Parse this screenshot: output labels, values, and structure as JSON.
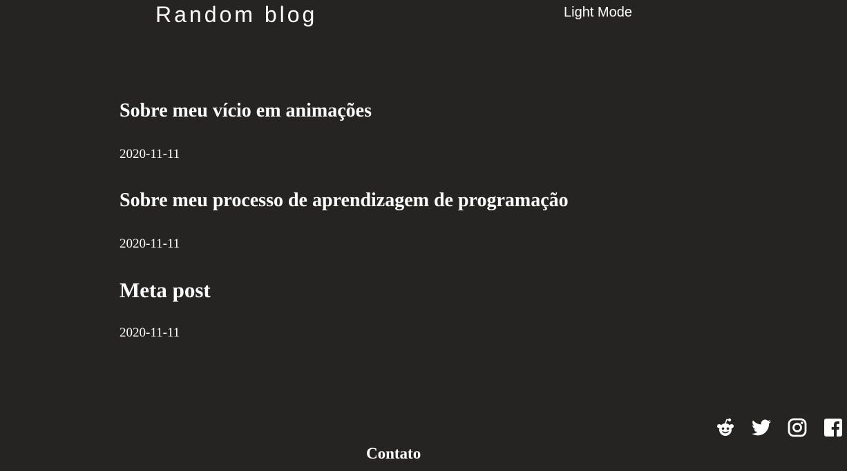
{
  "header": {
    "site_title": "Random blog",
    "theme_toggle_label": "Light Mode"
  },
  "posts": [
    {
      "title": "Sobre meu vício em animações",
      "date": "2020-11-11"
    },
    {
      "title": "Sobre meu processo de aprendizagem de programação",
      "date": "2020-11-11"
    },
    {
      "title": "Meta post",
      "date": "2020-11-11"
    }
  ],
  "footer": {
    "social_icons": [
      "reddit-icon",
      "twitter-icon",
      "instagram-icon",
      "facebook-icon"
    ],
    "contact_heading": "Contato"
  },
  "colors": {
    "background": "#252423",
    "text": "#ffffff"
  }
}
